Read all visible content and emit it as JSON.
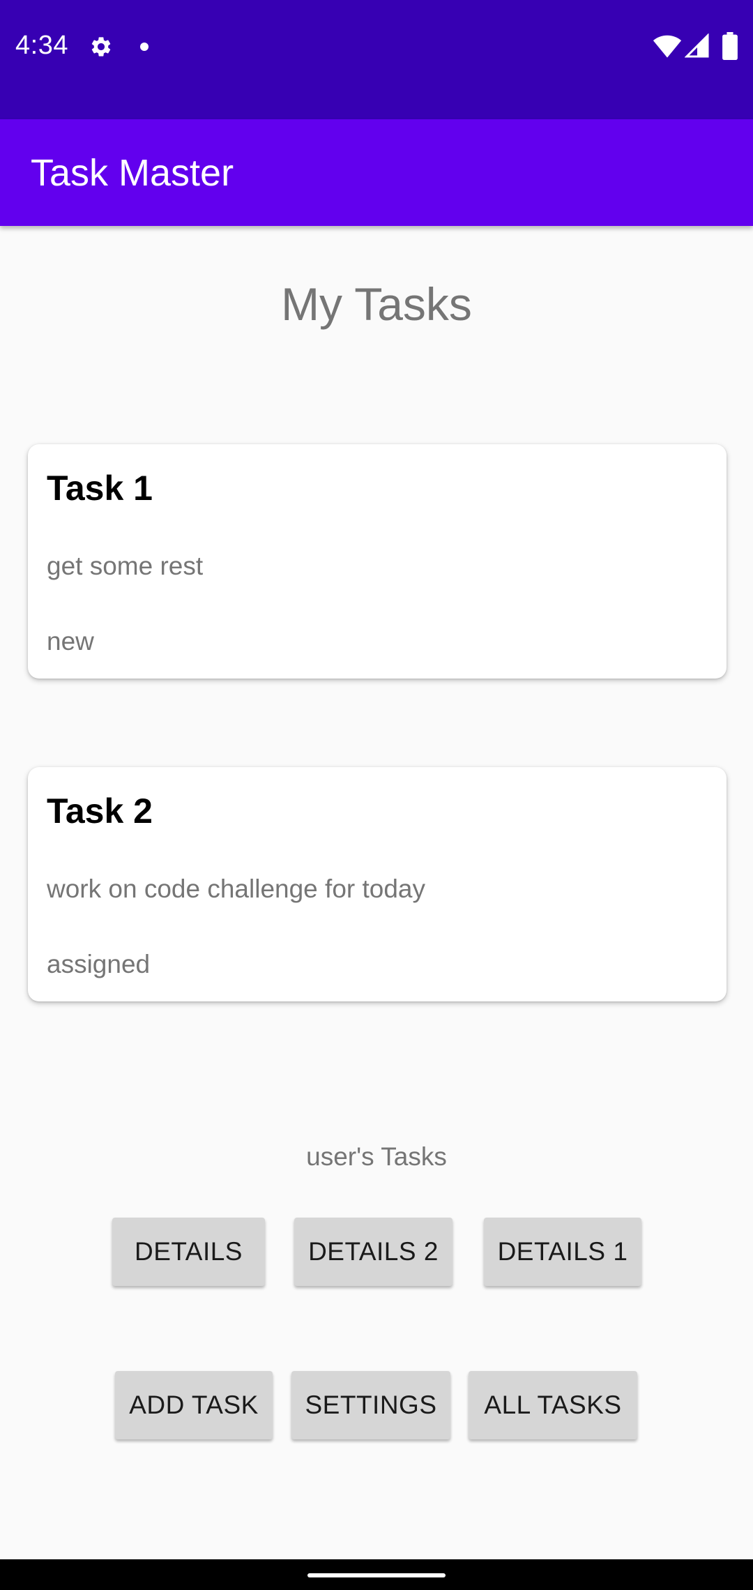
{
  "status_bar": {
    "time": "4:34",
    "icons": [
      "gear-icon",
      "notification-dot-icon",
      "wifi-icon",
      "signal-icon",
      "battery-icon"
    ]
  },
  "app_bar": {
    "title": "Task Master"
  },
  "main": {
    "heading": "My Tasks",
    "tasks": [
      {
        "title": "Task 1",
        "body": "get some rest",
        "state": "new"
      },
      {
        "title": "Task 2",
        "body": "work on code challenge for today",
        "state": "assigned"
      }
    ],
    "user_tasks_label": "user's Tasks",
    "detail_buttons": [
      "DETAILS",
      "DETAILS 2",
      "DETAILS 1"
    ],
    "action_buttons": [
      "ADD TASK",
      "SETTINGS",
      "ALL TASKS"
    ]
  },
  "colors": {
    "status_bar": "#3700b3",
    "app_bar": "#6200ee",
    "background": "#fafafa",
    "button": "#d6d6d6"
  }
}
